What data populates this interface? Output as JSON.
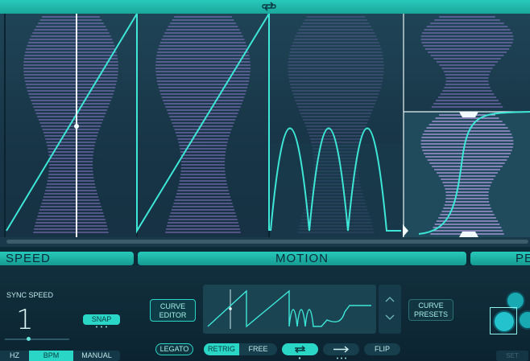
{
  "header": {
    "loop_icon": "loop-arrows-icon"
  },
  "sections": {
    "speed": "SPEED",
    "motion": "MOTION",
    "next": "PE"
  },
  "speed": {
    "sync_label": "SYNC SPEED",
    "value": "1",
    "snap_label": "SNAP",
    "modes": {
      "hz": "HZ",
      "bpm": "BPM",
      "manual": "MANUAL"
    },
    "selected_mode": "BPM"
  },
  "motion": {
    "curve_editor_label": "CURVE EDITOR",
    "curve_presets_label": "CURVE PRESETS",
    "legato_label": "LEGATO",
    "retrig_label": "RETRIG",
    "free_label": "FREE",
    "flip_label": "FLIP",
    "loop_icon": "loop-icon",
    "forward_icon": "forward-arrow-icon",
    "up_icon": "chevron-up-icon",
    "down_icon": "chevron-down-icon"
  },
  "right_panel": {
    "set_label": "SET"
  },
  "colors": {
    "accent": "#2ad7c7",
    "waveform": "#9b7fd6",
    "curve": "#3de6d6",
    "background": "#0d2a38"
  }
}
